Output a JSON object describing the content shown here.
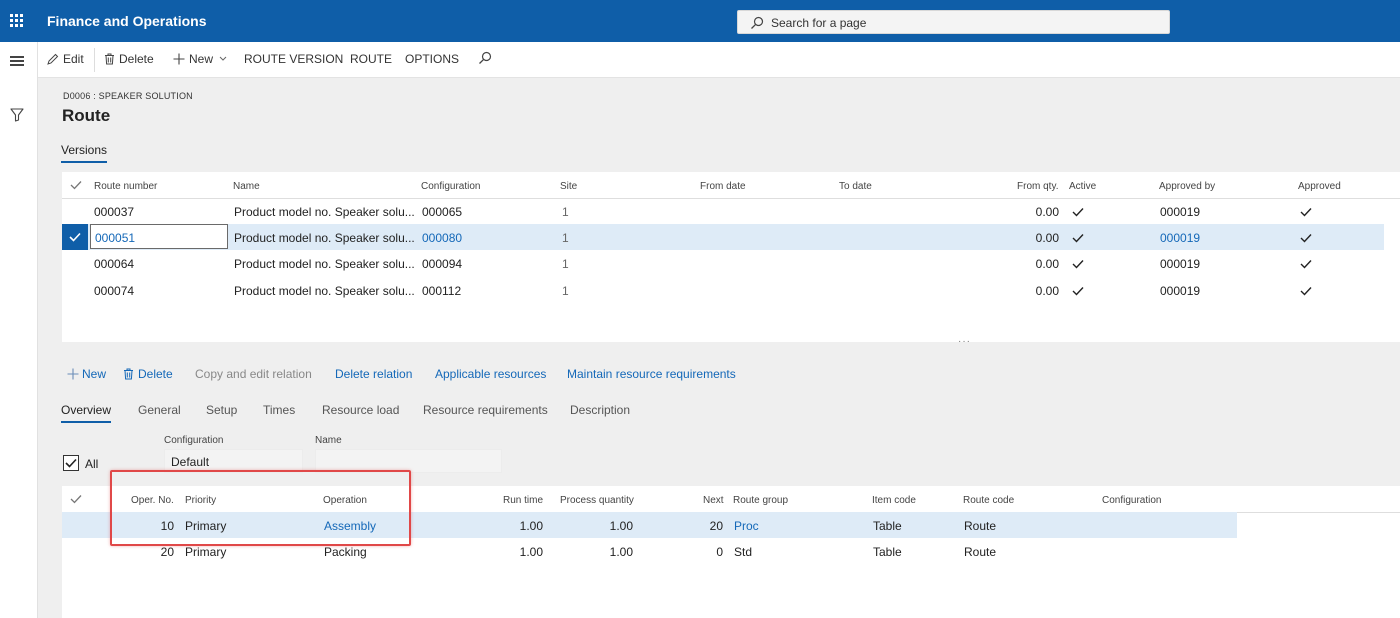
{
  "app": {
    "title": "Finance and Operations"
  },
  "search": {
    "placeholder": "Search for a page"
  },
  "actionbar": {
    "edit": "Edit",
    "delete": "Delete",
    "new": "New",
    "route_version": "ROUTE VERSION",
    "route": "ROUTE",
    "options": "OPTIONS"
  },
  "header": {
    "breadcrumb": "D0006 : SPEAKER SOLUTION",
    "title": "Route",
    "tab": "Versions"
  },
  "versions": {
    "columns": [
      "Route number",
      "Name",
      "Configuration",
      "Site",
      "From date",
      "To date",
      "From qty.",
      "Active",
      "Approved by",
      "Approved"
    ],
    "rows": [
      {
        "route_number": "000037",
        "name": "Product model no. Speaker solu...",
        "configuration": "000065",
        "site": "1",
        "from_qty": "0.00",
        "approved_by": "000019"
      },
      {
        "route_number": "000051",
        "name": "Product model no. Speaker solu...",
        "configuration": "000080",
        "site": "1",
        "from_qty": "0.00",
        "approved_by": "000019"
      },
      {
        "route_number": "000064",
        "name": "Product model no. Speaker solu...",
        "configuration": "000094",
        "site": "1",
        "from_qty": "0.00",
        "approved_by": "000019"
      },
      {
        "route_number": "000074",
        "name": "Product model no. Speaker solu...",
        "configuration": "000112",
        "site": "1",
        "from_qty": "0.00",
        "approved_by": "000019"
      }
    ]
  },
  "lines_toolbar": {
    "new": "New",
    "delete": "Delete",
    "copy_edit": "Copy and edit relation",
    "delete_relation": "Delete relation",
    "applicable_resources": "Applicable resources",
    "maintain_requirements": "Maintain resource requirements"
  },
  "lines_tabs": [
    "Overview",
    "General",
    "Setup",
    "Times",
    "Resource load",
    "Resource requirements",
    "Description"
  ],
  "filters": {
    "all_label": "All",
    "configuration_label": "Configuration",
    "configuration_value": "Default",
    "name_label": "Name",
    "name_value": ""
  },
  "operations": {
    "columns": [
      "Oper. No.",
      "Priority",
      "Operation",
      "Run time",
      "Process quantity",
      "Next",
      "Route group",
      "Item code",
      "Route code",
      "Configuration"
    ],
    "rows": [
      {
        "oper_no": "10",
        "priority": "Primary",
        "operation": "Assembly",
        "run_time": "1.00",
        "process_qty": "1.00",
        "next": "20",
        "route_group": "Proc",
        "item_code": "Table",
        "route_code": "Route"
      },
      {
        "oper_no": "20",
        "priority": "Primary",
        "operation": "Packing",
        "run_time": "1.00",
        "process_qty": "1.00",
        "next": "0",
        "route_group": "Std",
        "item_code": "Table",
        "route_code": "Route"
      }
    ]
  },
  "colors": {
    "brand": "#0f5ea8",
    "link": "#1468b8",
    "selected_row": "#deebf7",
    "highlight": "#e04848"
  }
}
